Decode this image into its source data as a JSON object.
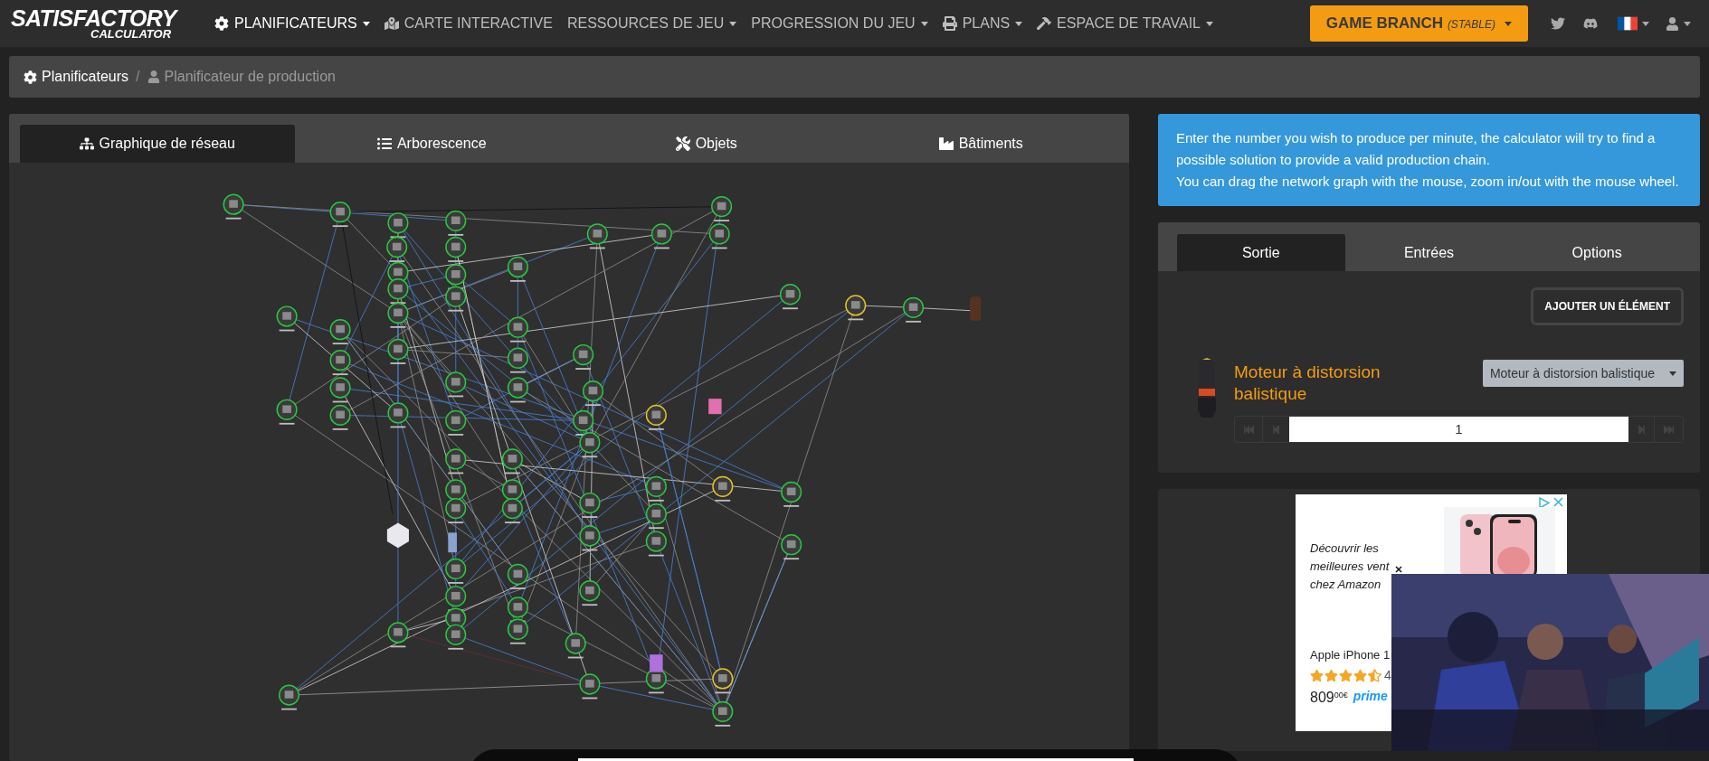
{
  "logo": {
    "title": "SATISFACTORY",
    "subtitle": "CALCULATOR"
  },
  "nav": [
    {
      "label": "PLANIFICATEURS",
      "selected": true,
      "dropdown": true
    },
    {
      "label": "CARTE INTERACTIVE",
      "selected": false,
      "dropdown": false
    },
    {
      "label": "RESSOURCES DE JEU",
      "selected": false,
      "dropdown": true
    },
    {
      "label": "PROGRESSION DU JEU",
      "selected": false,
      "dropdown": true
    },
    {
      "label": "PLANS",
      "selected": false,
      "dropdown": true
    },
    {
      "label": "ESPACE DE TRAVAIL",
      "selected": false,
      "dropdown": true
    }
  ],
  "game_branch": {
    "label": "GAME BRANCH",
    "tag": "(STABLE)"
  },
  "breadcrumb_separator": "/",
  "breadcrumb": [
    {
      "label": "Planificateurs",
      "current": false
    },
    {
      "label": "Planificateur de production",
      "current": true
    }
  ],
  "graph_tabs": [
    {
      "label": "Graphique de réseau",
      "selected": true
    },
    {
      "label": "Arborescence",
      "selected": false
    },
    {
      "label": "Objets",
      "selected": false
    },
    {
      "label": "Bâtiments",
      "selected": false
    }
  ],
  "info": [
    "Enter the number you wish to produce per minute, the calculator will try to find a possible solution to provide a valid production chain.",
    "You can drag the network graph with the mouse, zoom in/out with the mouse wheel."
  ],
  "output_tabs": [
    {
      "label": "Sortie",
      "selected": true
    },
    {
      "label": "Entrées",
      "selected": false
    },
    {
      "label": "Options",
      "selected": false
    }
  ],
  "add_button": "AJOUTER UN ÉLÉMENT",
  "product": {
    "name": "Moteur à distorsion balistique",
    "recipe": "Moteur à distorsion balistique",
    "quantity": "1"
  },
  "ad": {
    "lines": [
      "Découvrir les",
      "meilleures vent",
      "chez Amazon"
    ],
    "title": "Apple iPhone 1",
    "stars": 4.5,
    "rating": "4",
    "price": "809",
    "cents": "00€",
    "badge": "prime"
  }
}
